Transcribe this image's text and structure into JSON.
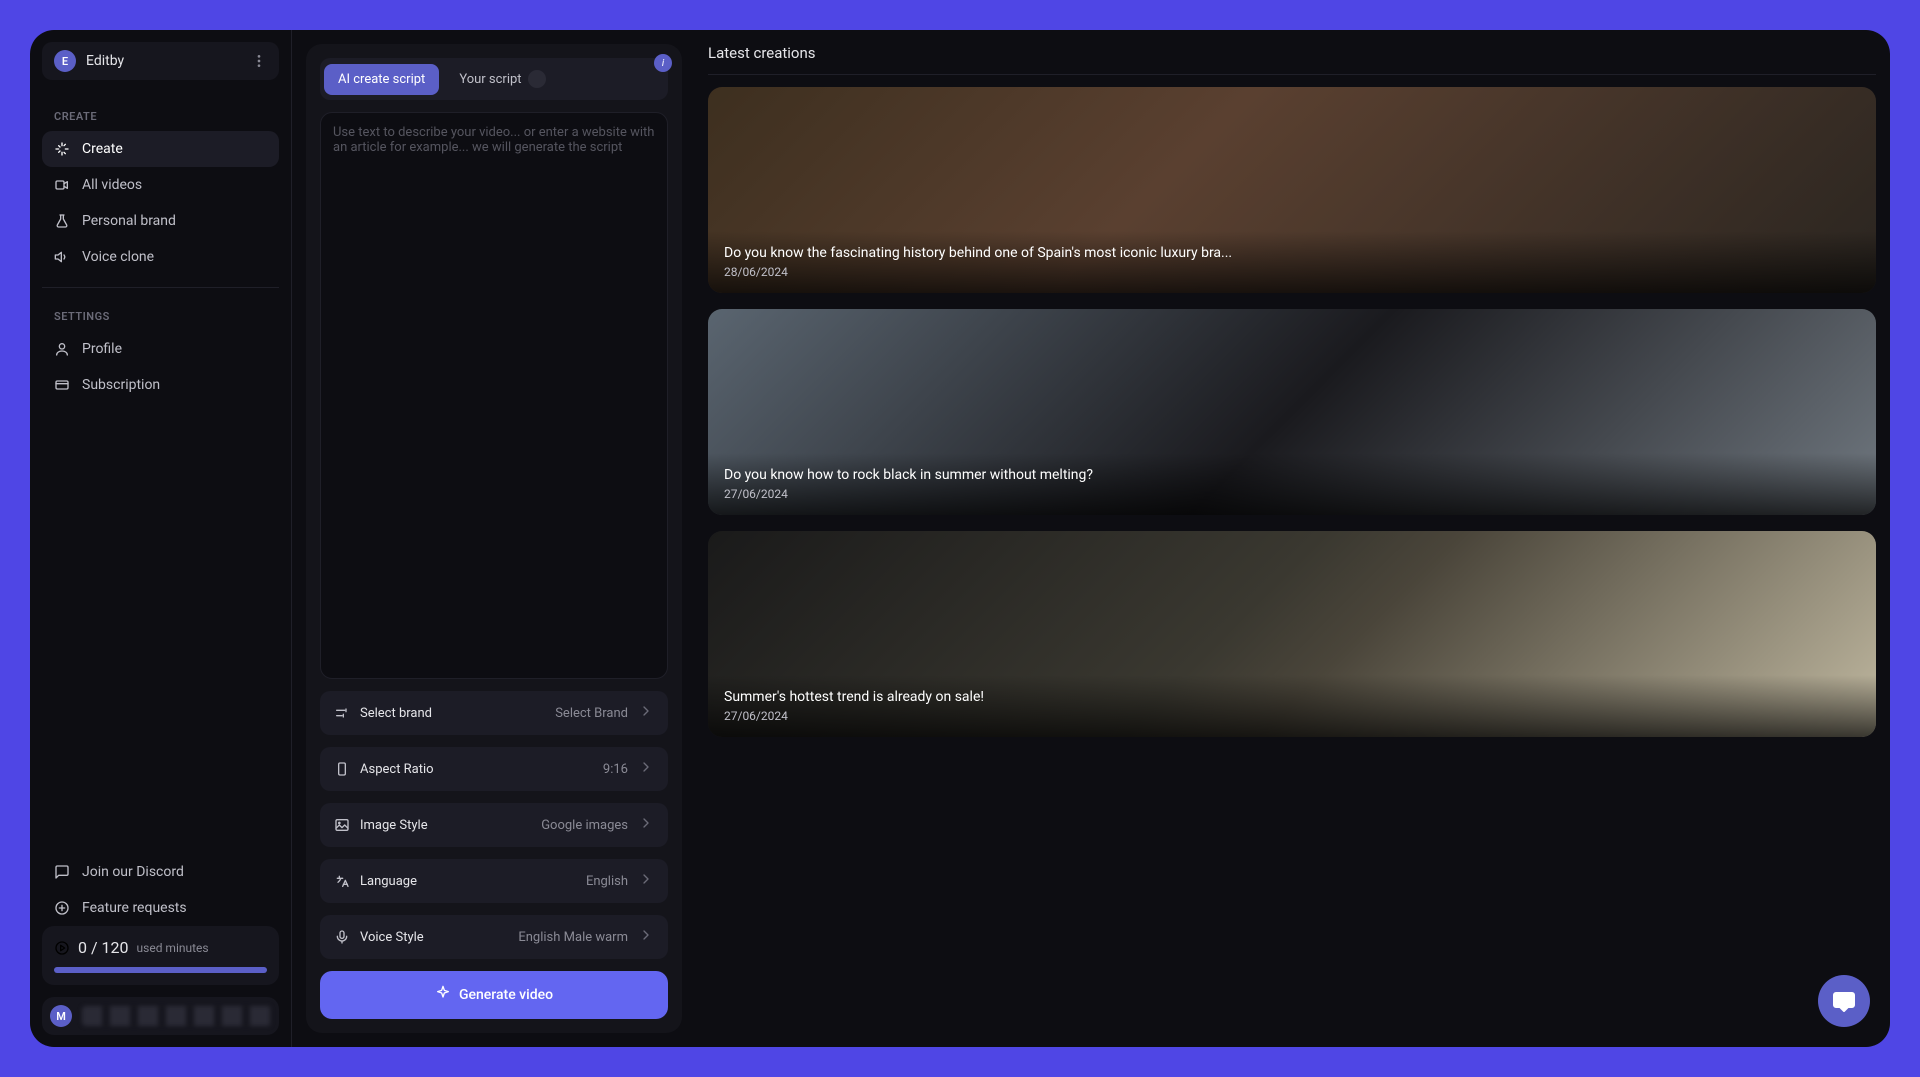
{
  "workspace": {
    "avatar_letter": "E",
    "name": "Editby"
  },
  "sidebar": {
    "create_label": "CREATE",
    "settings_label": "SETTINGS",
    "items": {
      "create": "Create",
      "all_videos": "All videos",
      "personal_brand": "Personal brand",
      "voice_clone": "Voice clone",
      "profile": "Profile",
      "subscription": "Subscription",
      "discord": "Join our Discord",
      "feature_requests": "Feature requests"
    }
  },
  "usage": {
    "count": "0 / 120",
    "label": "used minutes"
  },
  "footer": {
    "avatar_letter": "M"
  },
  "tabs": {
    "ai_script": "AI create script",
    "your_script": "Your script"
  },
  "textarea_placeholder": "Use text to describe your video... or enter a website with an article for example... we will generate the script",
  "options": {
    "brand": {
      "label": "Select brand",
      "value": "Select Brand"
    },
    "aspect": {
      "label": "Aspect Ratio",
      "value": "9:16"
    },
    "image": {
      "label": "Image Style",
      "value": "Google images"
    },
    "language": {
      "label": "Language",
      "value": "English"
    },
    "voice": {
      "label": "Voice Style",
      "value": "English Male warm"
    }
  },
  "generate_label": "Generate video",
  "latest_label": "Latest creations",
  "creations": [
    {
      "title": "Do you know the fascinating history behind one of Spain's most iconic luxury bra...",
      "date": "28/06/2024"
    },
    {
      "title": "Do you know how to rock black in summer without melting?",
      "date": "27/06/2024"
    },
    {
      "title": "Summer's hottest trend is already on sale!",
      "date": "27/06/2024"
    }
  ]
}
